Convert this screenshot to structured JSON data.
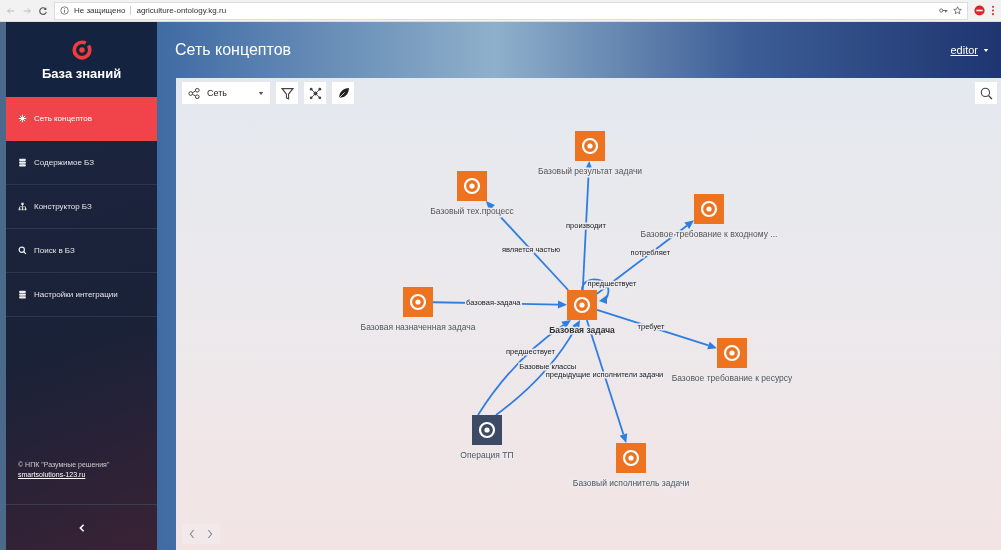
{
  "browser": {
    "security": "Не защищено",
    "url": "agriculture-ontology.kg.ru"
  },
  "sidebar": {
    "title": "База знаний",
    "items": [
      {
        "label": "Сеть концептов",
        "selected": true
      },
      {
        "label": "Содержимое БЗ",
        "selected": false
      },
      {
        "label": "Конструктор БЗ",
        "selected": false
      },
      {
        "label": "Поиск в БЗ",
        "selected": false
      },
      {
        "label": "Настройки интеграции",
        "selected": false
      }
    ],
    "footer": {
      "copyright": "© НПК \"Разумные решения\"",
      "link": "smartsolutions-123.ru"
    }
  },
  "header": {
    "title": "Сеть концептов",
    "user": "editor"
  },
  "toolbar": {
    "view": "Сеть"
  },
  "graph": {
    "nodes": [
      {
        "label": "Базовый результат задачи",
        "kind": "concept",
        "color": "#ee7320"
      },
      {
        "label": "Базовый тех.процесс",
        "kind": "concept",
        "color": "#ee7320"
      },
      {
        "label": "Базовое требование к входному ...",
        "kind": "concept",
        "color": "#ee7320"
      },
      {
        "label": "Базовая назначенная задача",
        "kind": "concept",
        "color": "#ee7320"
      },
      {
        "label": "Базовая задача",
        "kind": "main",
        "color": "#ee7320"
      },
      {
        "label": "Базовое требование к ресурсу",
        "kind": "concept",
        "color": "#ee7320"
      },
      {
        "label": "Операция ТП",
        "kind": "concept",
        "color": "#3d4a63"
      },
      {
        "label": "Базовый исполнитель задачи",
        "kind": "concept",
        "color": "#ee7320"
      }
    ],
    "edges": [
      {
        "label": "производит"
      },
      {
        "label": "является частью"
      },
      {
        "label": "потребляет"
      },
      {
        "label": "предшествует"
      },
      {
        "label": "базовая-задача"
      },
      {
        "label": "требует"
      },
      {
        "label": "предшествует"
      },
      {
        "label": "Базовые классы"
      },
      {
        "label": "предыдущие исполнители задачи"
      }
    ]
  }
}
